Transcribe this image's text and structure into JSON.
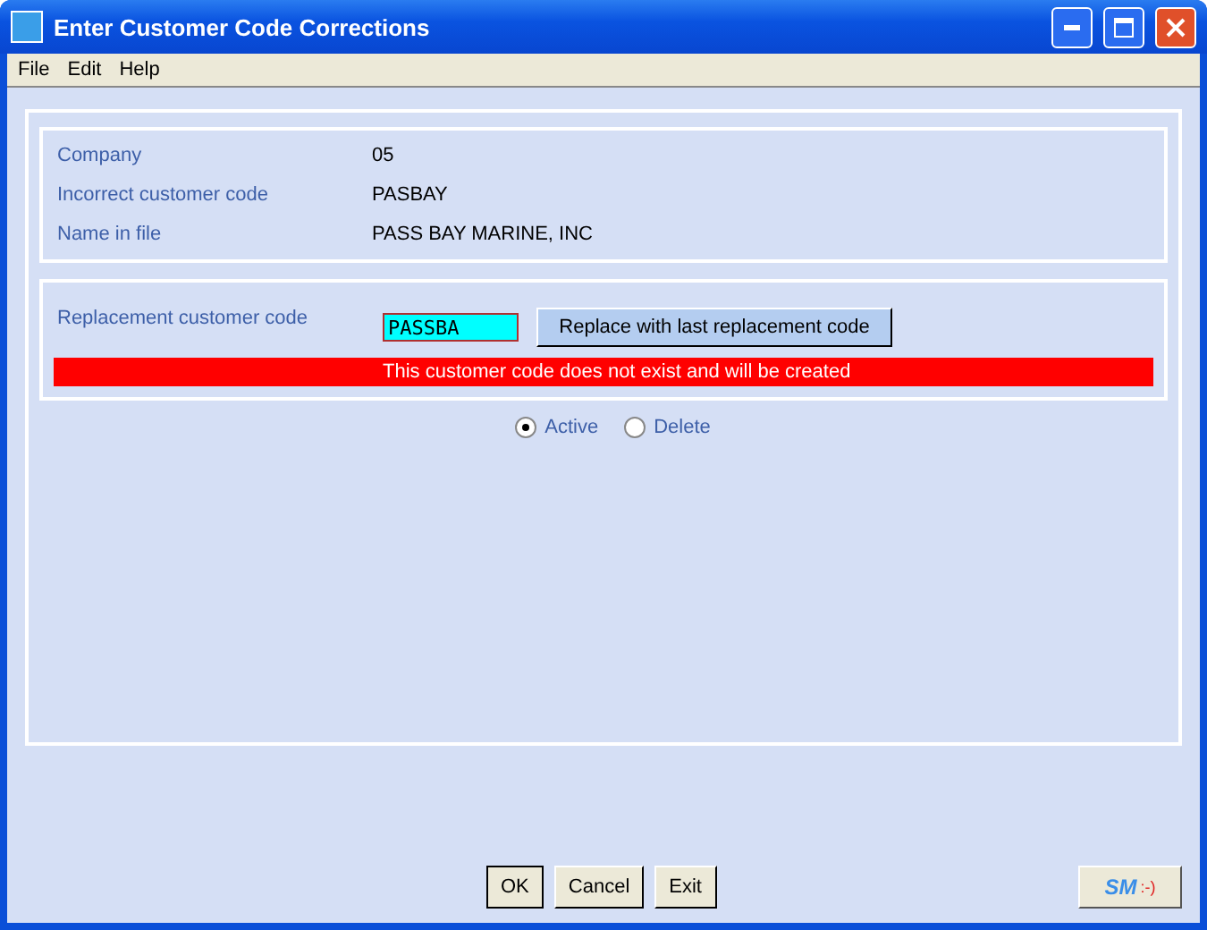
{
  "window": {
    "title": "Enter Customer Code Corrections"
  },
  "menu": [
    "File",
    "Edit",
    "Help"
  ],
  "info": [
    {
      "label": "Company",
      "value": "05"
    },
    {
      "label": "Incorrect customer code",
      "value": "PASBAY"
    },
    {
      "label": "Name in file",
      "value": "PASS BAY MARINE, INC"
    }
  ],
  "replacement": {
    "label": "Replacement customer code",
    "value": "PASSBA",
    "button": "Replace with last replacement code",
    "message": "This customer code does not exist and will be created"
  },
  "status_options": [
    {
      "label": "Active",
      "selected": true
    },
    {
      "label": "Delete",
      "selected": false
    }
  ],
  "buttons": [
    "OK",
    "Cancel",
    "Exit"
  ],
  "logo": {
    "main": "SM",
    "smiley": ":-)"
  }
}
